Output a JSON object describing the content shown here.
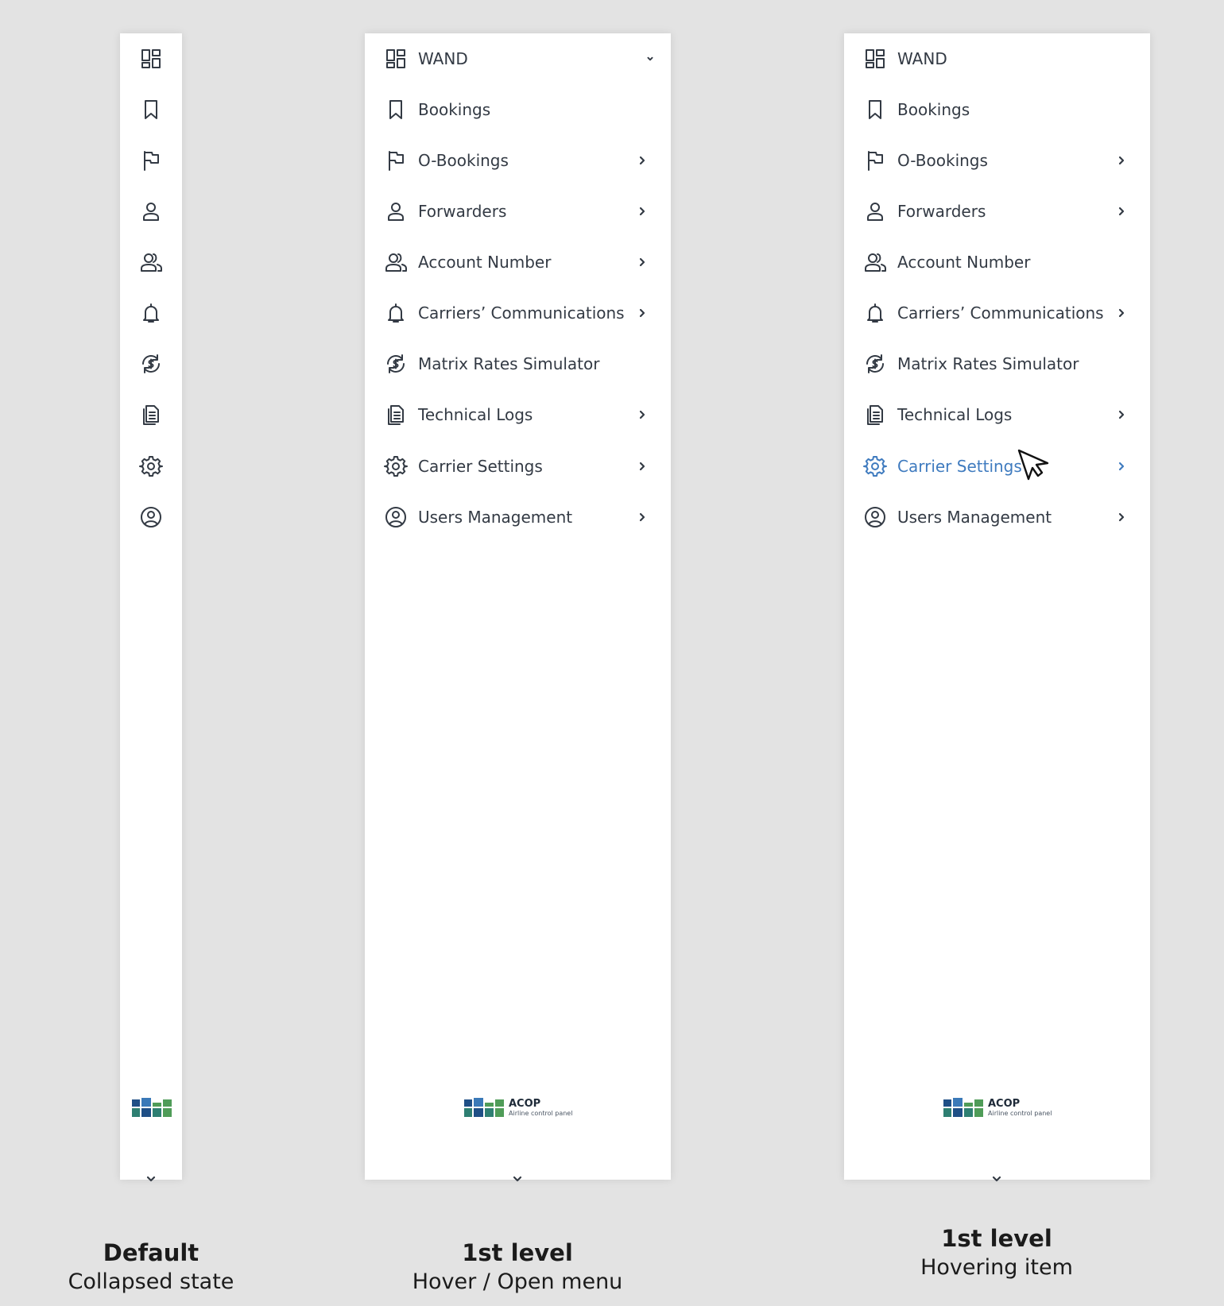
{
  "panels": {
    "collapsed": {
      "items": [
        {
          "icon": "dashboard-icon"
        },
        {
          "icon": "bookmark-icon"
        },
        {
          "icon": "flag-icon"
        },
        {
          "icon": "person-icon"
        },
        {
          "icon": "people-icon"
        },
        {
          "icon": "bell-icon"
        },
        {
          "icon": "currency-sync-icon"
        },
        {
          "icon": "document-icon"
        },
        {
          "icon": "gear-icon"
        },
        {
          "icon": "account-circle-icon"
        }
      ]
    },
    "open": {
      "items": [
        {
          "label": "WAND",
          "icon": "dashboard-icon",
          "arrow": "down"
        },
        {
          "label": "Bookings",
          "icon": "bookmark-icon",
          "arrow": "none"
        },
        {
          "label": "O-Bookings",
          "icon": "flag-icon",
          "arrow": "right"
        },
        {
          "label": "Forwarders",
          "icon": "person-icon",
          "arrow": "right"
        },
        {
          "label": "Account Number",
          "icon": "people-icon",
          "arrow": "right"
        },
        {
          "label": "Carriers’ Communications",
          "icon": "bell-icon",
          "arrow": "right"
        },
        {
          "label": "Matrix Rates Simulator",
          "icon": "currency-sync-icon",
          "arrow": "none"
        },
        {
          "label": "Technical Logs",
          "icon": "document-icon",
          "arrow": "right"
        },
        {
          "label": "Carrier Settings",
          "icon": "gear-icon",
          "arrow": "right"
        },
        {
          "label": "Users Management",
          "icon": "account-circle-icon",
          "arrow": "right"
        }
      ]
    },
    "hover": {
      "items": [
        {
          "label": "WAND",
          "icon": "dashboard-icon",
          "arrow": "none"
        },
        {
          "label": "Bookings",
          "icon": "bookmark-icon",
          "arrow": "none"
        },
        {
          "label": "O-Bookings",
          "icon": "flag-icon",
          "arrow": "right"
        },
        {
          "label": "Forwarders",
          "icon": "person-icon",
          "arrow": "right"
        },
        {
          "label": "Account Number",
          "icon": "people-icon",
          "arrow": "none"
        },
        {
          "label": "Carriers’ Communications",
          "icon": "bell-icon",
          "arrow": "right"
        },
        {
          "label": "Matrix Rates Simulator",
          "icon": "currency-sync-icon",
          "arrow": "none"
        },
        {
          "label": "Technical Logs",
          "icon": "document-icon",
          "arrow": "right"
        },
        {
          "label": "Carrier Settings",
          "icon": "gear-icon",
          "arrow": "right",
          "hovered": true
        },
        {
          "label": "Users Management",
          "icon": "account-circle-icon",
          "arrow": "right"
        }
      ]
    }
  },
  "logo": {
    "title": "ACOP",
    "subtitle": "Airline control panel"
  },
  "captions": {
    "default": {
      "title": "Default",
      "subtitle": "Collapsed state"
    },
    "open": {
      "title": "1st level",
      "subtitle": "Hover / Open menu"
    },
    "hover": {
      "title": "1st level",
      "subtitle": "Hovering item"
    }
  },
  "colors": {
    "background": "#e3e3e3",
    "panel": "#ffffff",
    "text": "#333a44",
    "accent": "#3f7bbf",
    "logo_dark_blue": "#1f4f86",
    "logo_blue": "#3a79b8",
    "logo_green": "#4f9c58",
    "logo_teal": "#2e7f72"
  }
}
